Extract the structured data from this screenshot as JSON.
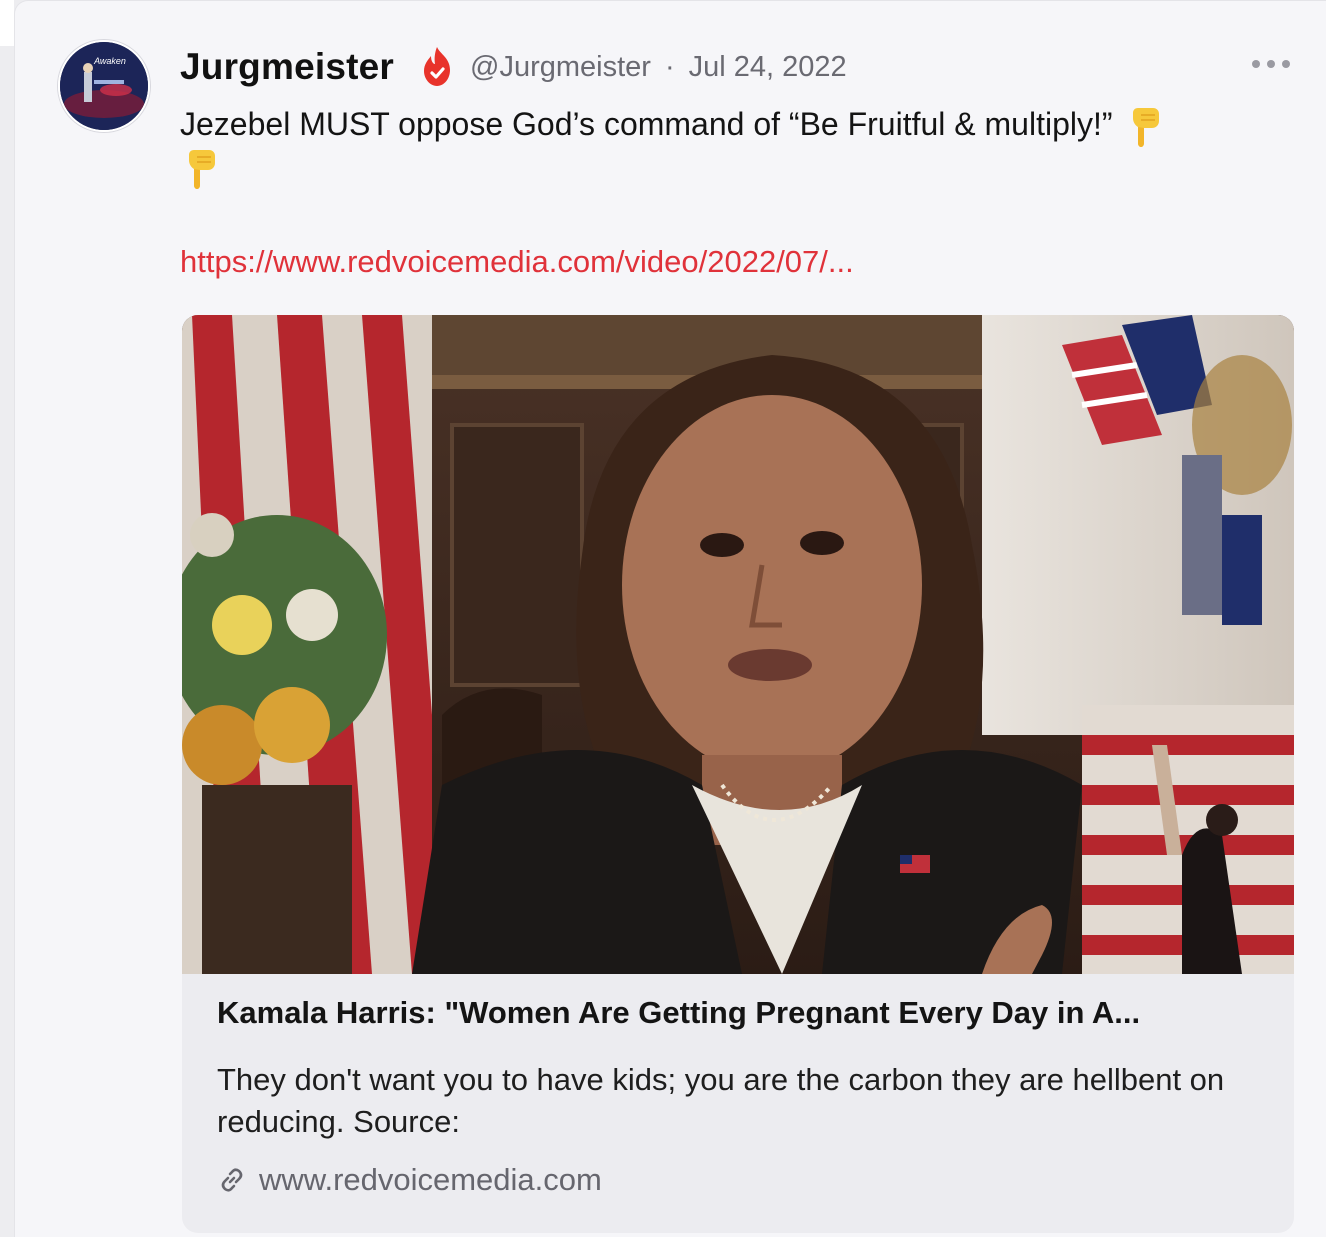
{
  "post": {
    "display_name": "Jurgmeister",
    "handle": "@Jurgmeister",
    "separator": "·",
    "date": "Jul 24, 2022",
    "text": "Jezebel MUST oppose God’s command of “Be Fruitful & multiply!”",
    "emoji_name": "backhand-index-pointing-down",
    "link_text": "https://www.redvoicemedia.com/video/2022/07/...",
    "avatar_caption": "Awaken"
  },
  "card": {
    "title": "Kamala Harris: \"Women Are Getting Pregnant Every Day in A...",
    "description": "They don't want you to have kids; you are the carbon they are hellbent on reducing. Source:",
    "domain": "www.redvoicemedia.com"
  },
  "colors": {
    "link": "#e0323a",
    "verified_badge": "#e8332b",
    "background": "#f6f6f9",
    "card_background": "#ececf0"
  }
}
